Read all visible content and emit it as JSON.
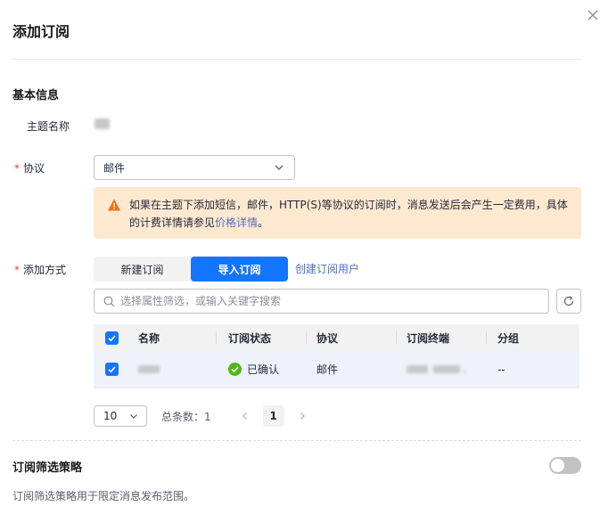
{
  "dialog": {
    "title": "添加订阅",
    "close_icon": "close-icon"
  },
  "basic_info": {
    "section_title": "基本信息",
    "topic_label": "主题名称",
    "protocol_label": "协议",
    "protocol_value": "邮件",
    "alert": {
      "text": "如果在主题下添加短信，邮件，HTTP(S)等协议的订阅时，消息发送后会产生一定费用，具体的计费详情请参见",
      "link": "价格详情",
      "suffix": "。"
    },
    "add_method_label": "添加方式",
    "tabs": [
      {
        "label": "新建订阅",
        "active": false
      },
      {
        "label": "导入订阅",
        "active": true
      }
    ],
    "create_user_link": "创建订阅用户"
  },
  "search": {
    "placeholder": "选择属性筛选，或输入关键字搜索"
  },
  "table": {
    "columns": [
      "名称",
      "订阅状态",
      "协议",
      "订阅终端",
      "分组"
    ],
    "rows": [
      {
        "status": "已确认",
        "protocol": "邮件",
        "group": "--"
      }
    ]
  },
  "pagination": {
    "page_size": "10",
    "total_label": "总条数：1",
    "current_page": "1"
  },
  "filter_policy": {
    "title": "订阅筛选策略",
    "description": "订阅筛选策略用于限定消息发布范围。",
    "enabled": false
  },
  "colors": {
    "primary": "#1475ff",
    "link": "#526ecc",
    "warning_bg": "#fde8d0",
    "required": "#e43e3e",
    "success": "#50b91a"
  }
}
